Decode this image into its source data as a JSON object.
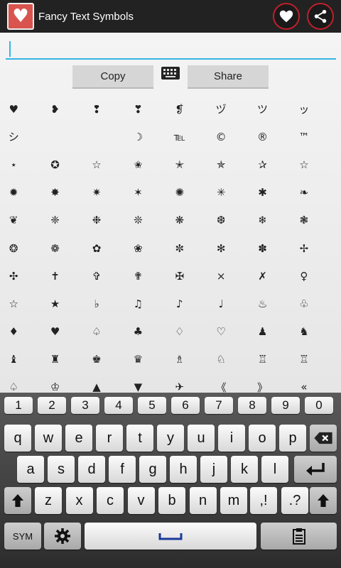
{
  "app": {
    "title": "Fancy Text Symbols",
    "icon": "heart-icon",
    "accent": "#33b5e5",
    "brand": "#d9534f"
  },
  "actions": {
    "favorite_icon": "heart-icon",
    "share_icon": "share-icon"
  },
  "editor": {
    "value": "",
    "placeholder": ""
  },
  "buttons": {
    "copy": "Copy",
    "share": "Share",
    "keyboard_icon": "keyboard-icon"
  },
  "symbols": [
    [
      "♥",
      "❥",
      "❢",
      "❣",
      "❡",
      "ヅ",
      "ツ",
      "ッ"
    ],
    [
      "シ",
      "",
      "",
      "☽",
      "℡",
      "©",
      "®",
      "™"
    ],
    [
      "⋆",
      "✪",
      "☆",
      "✬",
      "✭",
      "✯",
      "✰",
      "☆"
    ],
    [
      "✹",
      "✸",
      "✷",
      "✶",
      "✺",
      "✳",
      "✱",
      "❧"
    ],
    [
      "❦",
      "❈",
      "❉",
      "❊",
      "❋",
      "❆",
      "❄",
      "❃"
    ],
    [
      "❂",
      "❁",
      "✿",
      "❀",
      "✼",
      "✻",
      "✽",
      "✢"
    ],
    [
      "✣",
      "✝",
      "✞",
      "✟",
      "✠",
      "×",
      "✗",
      "♀"
    ],
    [
      "☆",
      "★",
      "♭",
      "♫",
      "♪",
      "♩",
      "♨",
      "♧"
    ],
    [
      "♦",
      "♥",
      "♤",
      "♣",
      "♢",
      "♡",
      "♟",
      "♞"
    ],
    [
      "♝",
      "♜",
      "♚",
      "♛",
      "♗",
      "♘",
      "♖",
      "♖"
    ],
    [
      "♤",
      "♔",
      "▲",
      "▼",
      "✈",
      "《",
      "》",
      "«"
    ]
  ],
  "keyboard": {
    "numbers": [
      "1",
      "2",
      "3",
      "4",
      "5",
      "6",
      "7",
      "8",
      "9",
      "0"
    ],
    "row1": [
      "q",
      "w",
      "e",
      "r",
      "t",
      "y",
      "u",
      "i",
      "o",
      "p"
    ],
    "row2": [
      "a",
      "s",
      "d",
      "f",
      "g",
      "h",
      "j",
      "k",
      "l"
    ],
    "row3": [
      "z",
      "x",
      "c",
      "v",
      "b",
      "n",
      "m"
    ],
    "punct1": ",!",
    "punct2": ".?",
    "sym": "SYM",
    "backspace_icon": "backspace-icon",
    "enter_icon": "enter-icon",
    "shift_icon": "shift-icon",
    "settings_icon": "gear-icon",
    "space_icon": "space-icon",
    "clipboard_icon": "clipboard-icon"
  }
}
